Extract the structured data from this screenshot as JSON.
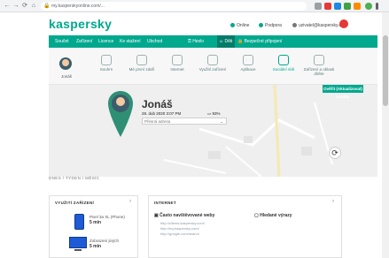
{
  "browser": {
    "url": "my.kasperskyonline.com/...",
    "colors": {
      "chrome": "#f1f3f4"
    }
  },
  "header": {
    "logo": "kaspersky",
    "status_online": "Online",
    "support": "Podpora",
    "account": "uzivatel@kaspersky.cz"
  },
  "nav": {
    "tabs": [
      "Součet",
      "Zařízení",
      "Licence",
      "Ke stažení",
      "Ubchod"
    ],
    "right_tabs": [
      "Heslo",
      "Děti",
      "Bezpečné připojení"
    ],
    "active": "Děti"
  },
  "child_toolbar": {
    "avatar_label": "Jonáš",
    "items": [
      "Souhrn",
      "Mé první zdaří",
      "Internet",
      "Využití zařízení",
      "Aplikace",
      "Sociální sítě",
      "Zařízení a oblasti dítěte"
    ]
  },
  "location": {
    "name": "Jonáš",
    "datetime": "28. dub 2020 3:07 PM",
    "battery": "93%",
    "address_placeholder": "Přesná adresa",
    "update_button": "Ověřit (Aktualizovat) polohu"
  },
  "breadcrumb": "DNES   /   TÝDEN   /   MĚSÍC",
  "devices_card": {
    "title": "VYUŽITÍ ZAŘÍZENÍ",
    "devices": [
      {
        "name": "Pixel 3a XL (Phone)",
        "time": "5 min"
      },
      {
        "name": "Zobrazení jiných",
        "time": "5 min"
      }
    ]
  },
  "internet_card": {
    "title": "INTERNET",
    "often_visited": "Často navštěvované weby",
    "searched": "Hledané výrazy",
    "urls": [
      "http://clients.kaspersky.com/",
      "http://my.kaspersky.com/",
      "http://google.com/search"
    ]
  }
}
